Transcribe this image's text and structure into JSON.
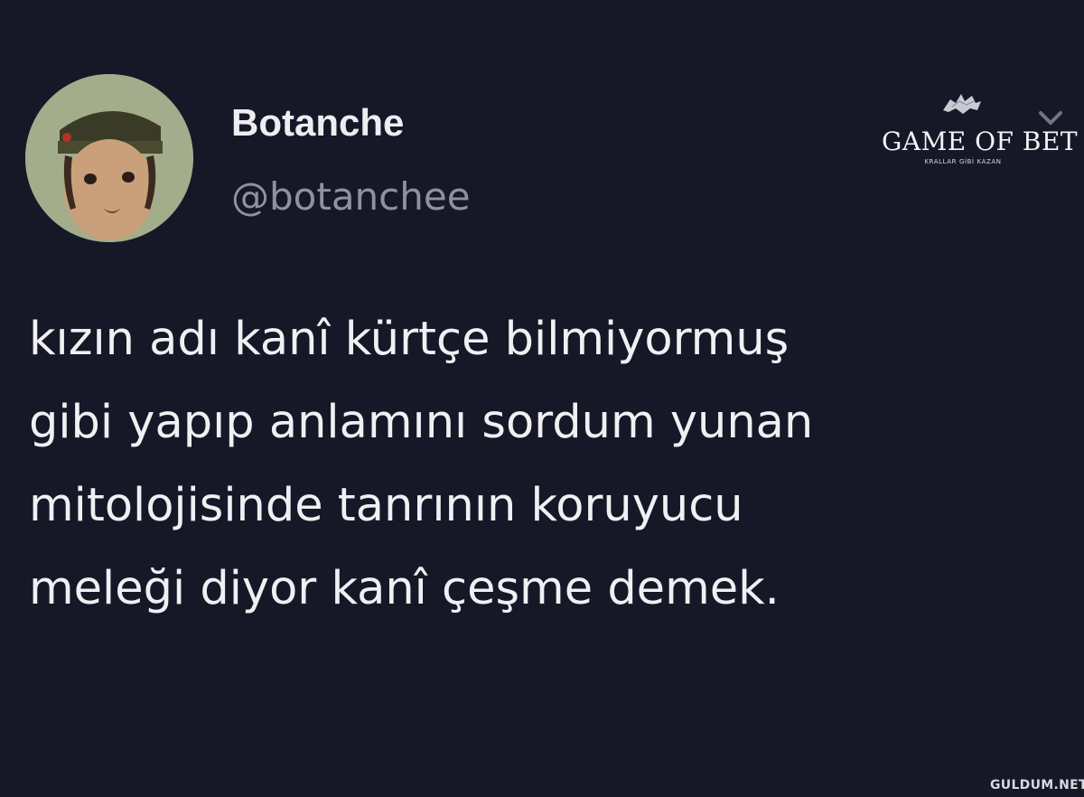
{
  "tweet": {
    "display_name": "Botanche",
    "handle": "@botanchee",
    "text_lines": [
      "kızın adı kanî kürtçe bilmiyormuş",
      "gibi yapıp anlamını sordum yunan",
      "mitolojisinde tanrının koruyucu",
      "meleği diyor kanî çeşme demek."
    ],
    "menu_icon": "chevron-down-icon",
    "avatar_icon": "profile-photo"
  },
  "logo": {
    "main": "GAME OF BET",
    "tagline": "KRALLAR GİBİ KAZAN",
    "emblem_icon": "wolf-emblem"
  },
  "watermark": "GULDUM.NET",
  "colors": {
    "background": "#161828",
    "text": "#f0f0f3",
    "secondary_text": "#8d92a3",
    "avatar_ring": "#9fa98b"
  }
}
